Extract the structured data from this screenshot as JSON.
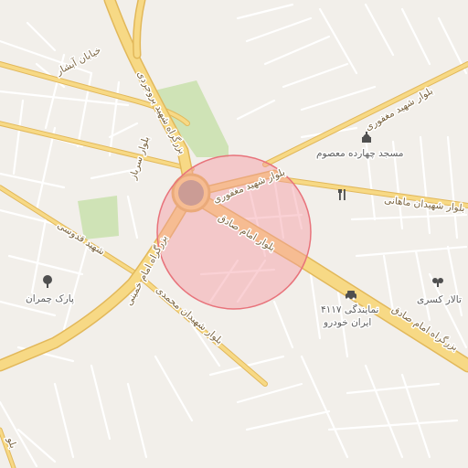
{
  "colors": {
    "background": "#f2efea",
    "minor_road": "#ffffff",
    "minor_road_casing": "#dcd6cc",
    "major_road": "#f7d985",
    "major_road_casing": "#e2b85a",
    "park": "#cfe3b6",
    "search_circle_fill": "#f7a8ad",
    "search_circle_stroke": "#e8737b",
    "roundabout": "#a99e8b"
  },
  "roads": {
    "khiaban_abshar": "خیابان آبشار",
    "bozorgrah_borujerdi": "بزرگراه شهید بروجردی",
    "bolvar_sarbaz": "بلوار سرباز",
    "bolvar_maghfouri_left": "بلوار شهید مغفوری",
    "bolvar_maghfouri_right": "بلوار شهید مغفوری",
    "bolvar_mahani": "بلوار شهیدان ماهانی",
    "bolvar_imam_sadegh": "بلوار امام صادق",
    "bozorgrah_imam_khomeini": "بزرگراه امام خمینی",
    "shahid_ghodousi": "شهید قدوسی",
    "bolvar_mohammadi": "بلوار شهیدان محمدی",
    "bozorgrah_imam_sadegh": "بزرگراه امام صادق",
    "bolvar_bottom": "بلو"
  },
  "pois": {
    "masjed": {
      "name": "مسجد چهارده معصوم",
      "icon": "mosque-icon"
    },
    "restaurant": {
      "icon": "restaurant-icon"
    },
    "talar": {
      "name": "تالار کسری",
      "icon": "banquet-hall-icon"
    },
    "namayandegi": {
      "line1": "نمایندگی ۴۱۱۷",
      "line2": "ایران خودرو",
      "icon": "car-dealer-icon"
    },
    "park_chamran": {
      "name": "پارک چمران",
      "icon": "park-icon"
    }
  }
}
